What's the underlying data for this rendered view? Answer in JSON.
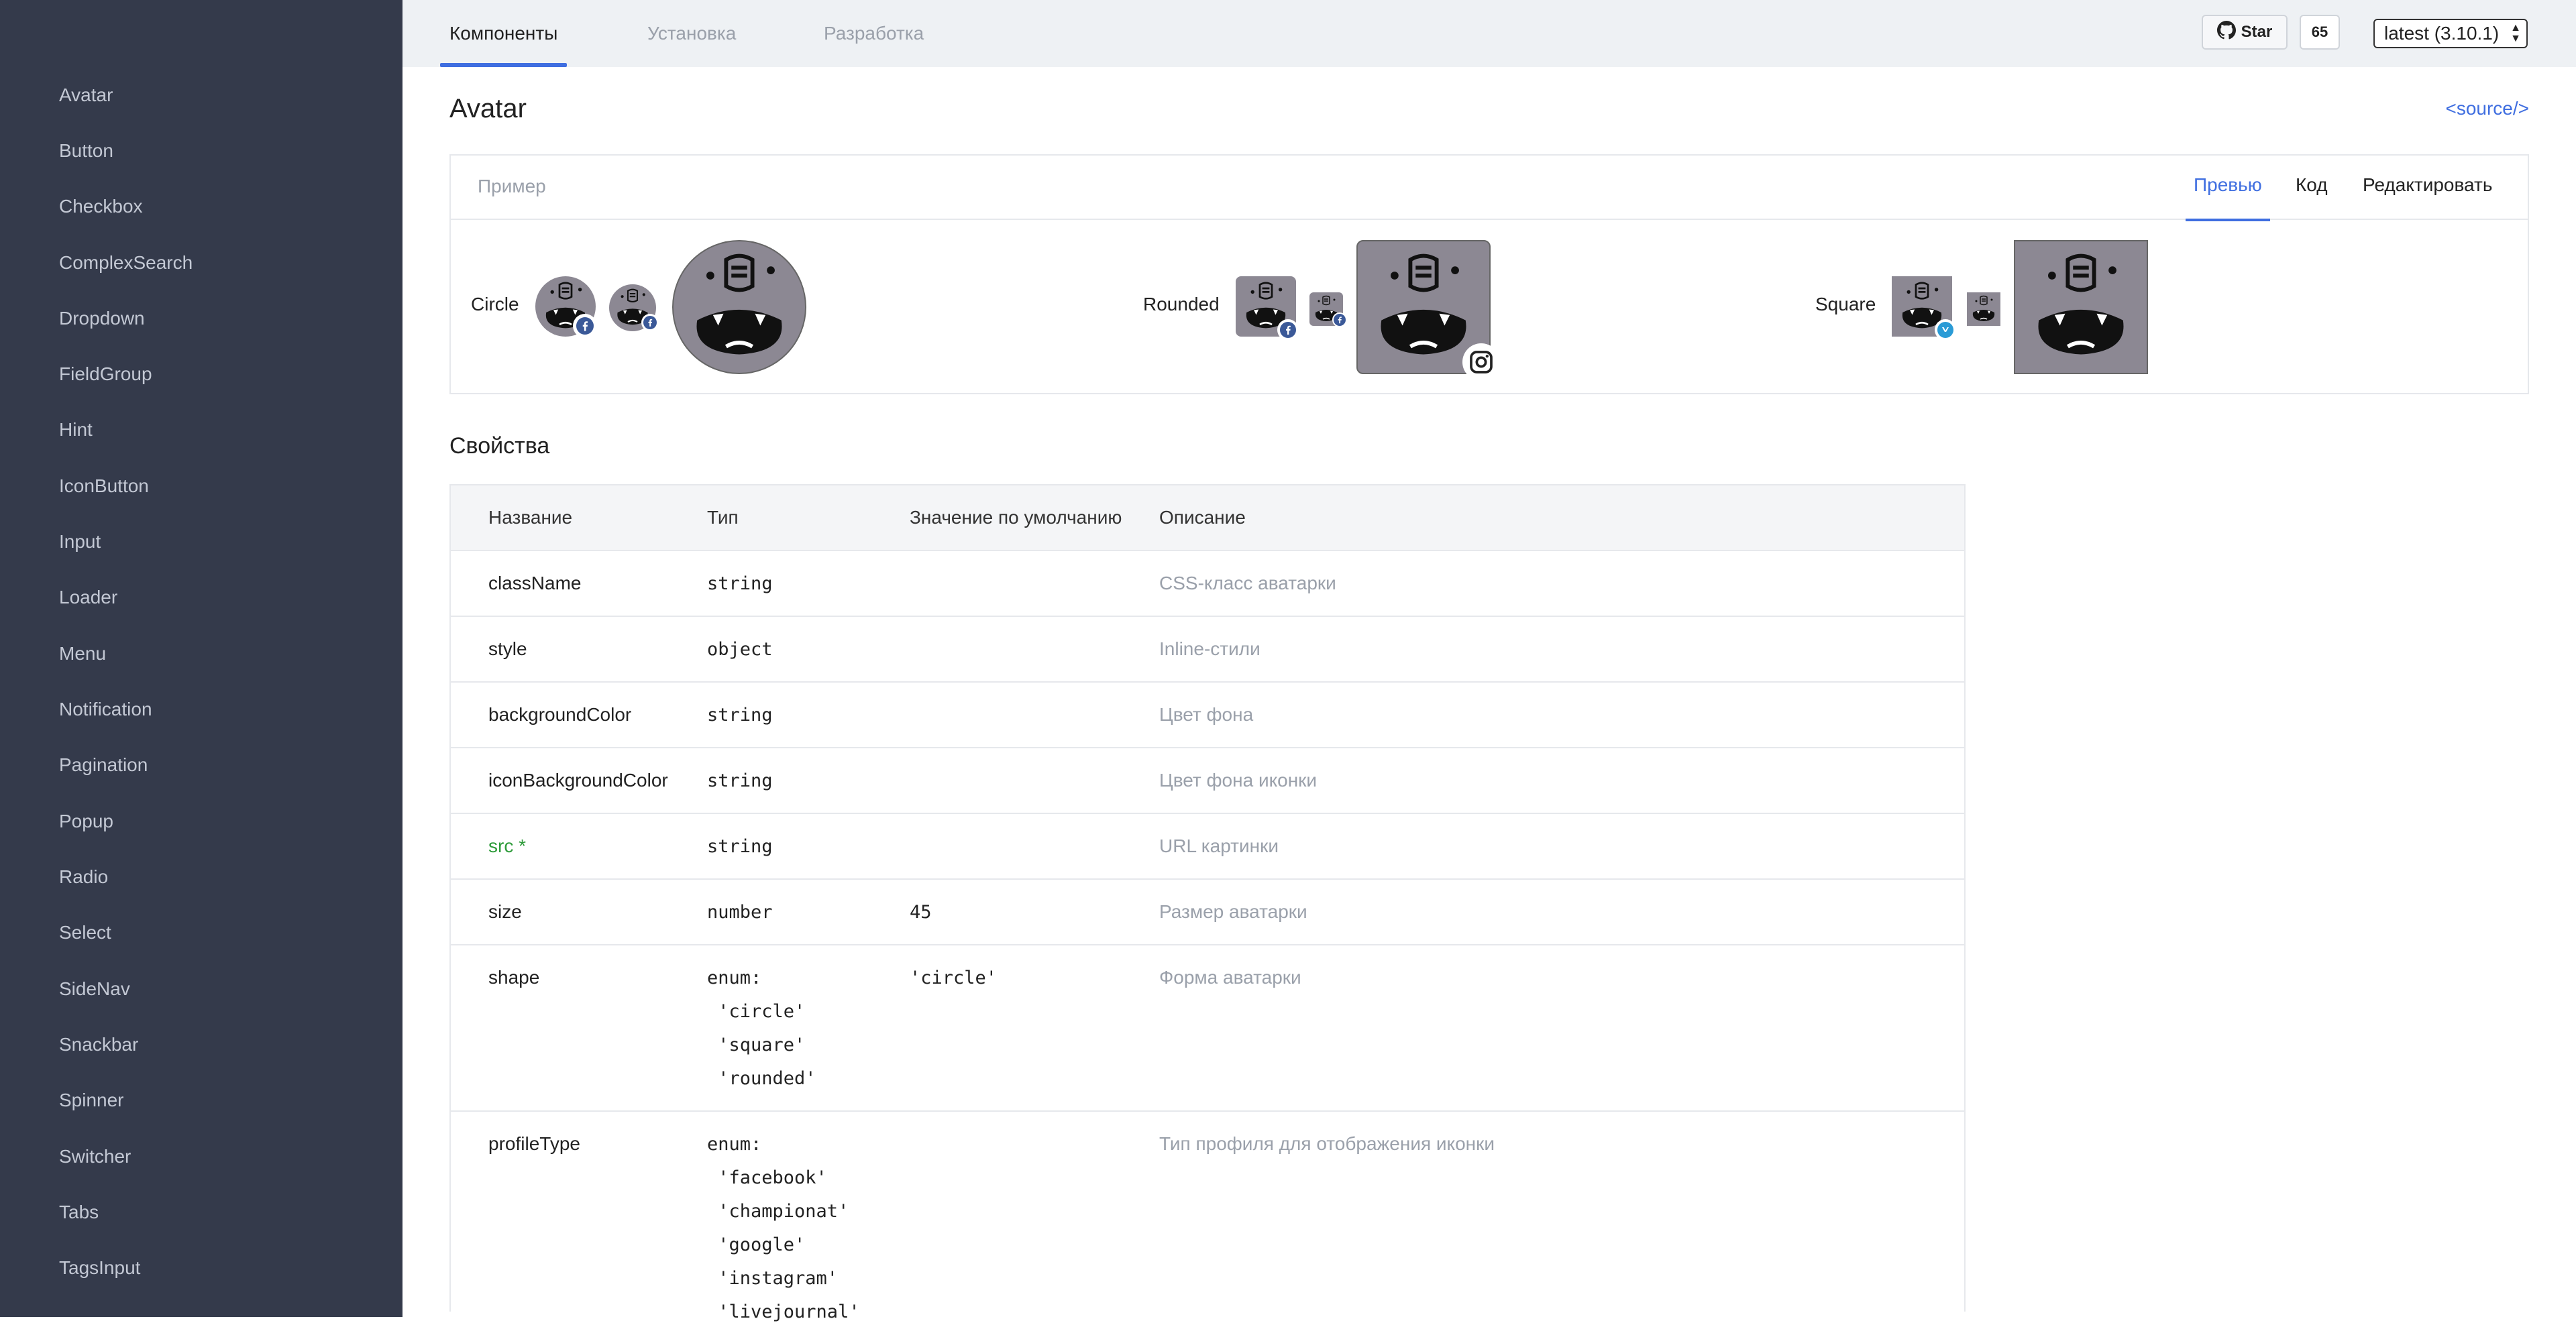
{
  "sidebar": {
    "items": [
      "Avatar",
      "Button",
      "Checkbox",
      "ComplexSearch",
      "Dropdown",
      "FieldGroup",
      "Hint",
      "IconButton",
      "Input",
      "Loader",
      "Menu",
      "Notification",
      "Pagination",
      "Popup",
      "Radio",
      "Select",
      "SideNav",
      "Snackbar",
      "Spinner",
      "Switcher",
      "Tabs",
      "TagsInput"
    ]
  },
  "topbar": {
    "tabs": [
      "Компоненты",
      "Установка",
      "Разработка"
    ],
    "active_tab": "Компоненты",
    "star_label": "Star",
    "star_count": "65",
    "version": "latest (3.10.1)"
  },
  "page": {
    "title": "Avatar",
    "source_link": "<source/>"
  },
  "example": {
    "label": "Пример",
    "tabs": [
      "Превью",
      "Код",
      "Редактировать"
    ],
    "active_tab": "Превью",
    "demos": [
      "Circle",
      "Rounded",
      "Square"
    ]
  },
  "props": {
    "section_title": "Свойства",
    "headers": [
      "Название",
      "Тип",
      "Значение по умолчанию",
      "Описание"
    ],
    "rows": [
      {
        "name": "className",
        "type": "string",
        "default": "",
        "description": "CSS-класс аватарки",
        "required": false
      },
      {
        "name": "style",
        "type": "object",
        "default": "",
        "description": "Inline-стили",
        "required": false
      },
      {
        "name": "backgroundColor",
        "type": "string",
        "default": "",
        "description": "Цвет фона",
        "required": false
      },
      {
        "name": "iconBackgroundColor",
        "type": "string",
        "default": "",
        "description": "Цвет фона иконки",
        "required": false
      },
      {
        "name": "src *",
        "type": "string",
        "default": "",
        "description": "URL картинки",
        "required": true
      },
      {
        "name": "size",
        "type": "number",
        "default": "45",
        "description": "Размер аватарки",
        "required": false
      },
      {
        "name": "shape",
        "type": "enum:\n 'circle'\n 'square'\n 'rounded'",
        "default": "'circle'",
        "description": "Форма аватарки",
        "required": false
      },
      {
        "name": "profileType",
        "type": "enum:\n 'facebook'\n 'championat'\n 'google'\n 'instagram'\n 'livejournal'",
        "default": "",
        "description": "Тип профиля для отображения иконки",
        "required": false
      }
    ]
  },
  "colors": {
    "sidebar_bg": "#343a4b",
    "accent": "#3f6ee0",
    "required": "#2e9b3a",
    "avatar_bg": "#8c8893"
  }
}
